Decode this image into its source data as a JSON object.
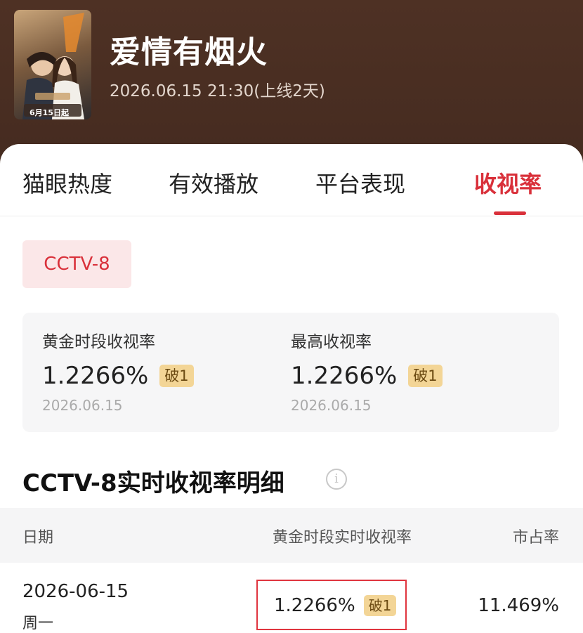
{
  "show": {
    "title": "爱情有烟火",
    "subtitle": "2026.06.15 21:30(上线2天)",
    "poster_text": "6月15日起"
  },
  "tabs": [
    {
      "label": "猫眼热度",
      "active": false
    },
    {
      "label": "有效播放",
      "active": false
    },
    {
      "label": "平台表现",
      "active": false
    },
    {
      "label": "收视率",
      "active": true
    }
  ],
  "channel_chip": "CCTV-8",
  "stats": {
    "prime": {
      "label": "黄金时段收视率",
      "value": "1.2266%",
      "badge": "破1",
      "date": "2026.06.15"
    },
    "peak": {
      "label": "最高收视率",
      "value": "1.2266%",
      "badge": "破1",
      "date": "2026.06.15"
    }
  },
  "detail": {
    "title": "CCTV-8实时收视率明细",
    "info_icon": "i",
    "columns": [
      "日期",
      "黄金时段实时收视率",
      "市占率"
    ],
    "rows": [
      {
        "date": "2026-06-15",
        "weekday": "周一",
        "rating": "1.2266%",
        "badge": "破1",
        "share": "11.469%"
      }
    ]
  },
  "colors": {
    "accent": "#d9303a",
    "header_bg": "#4b2f22",
    "badge_bg": "#f3d596"
  }
}
